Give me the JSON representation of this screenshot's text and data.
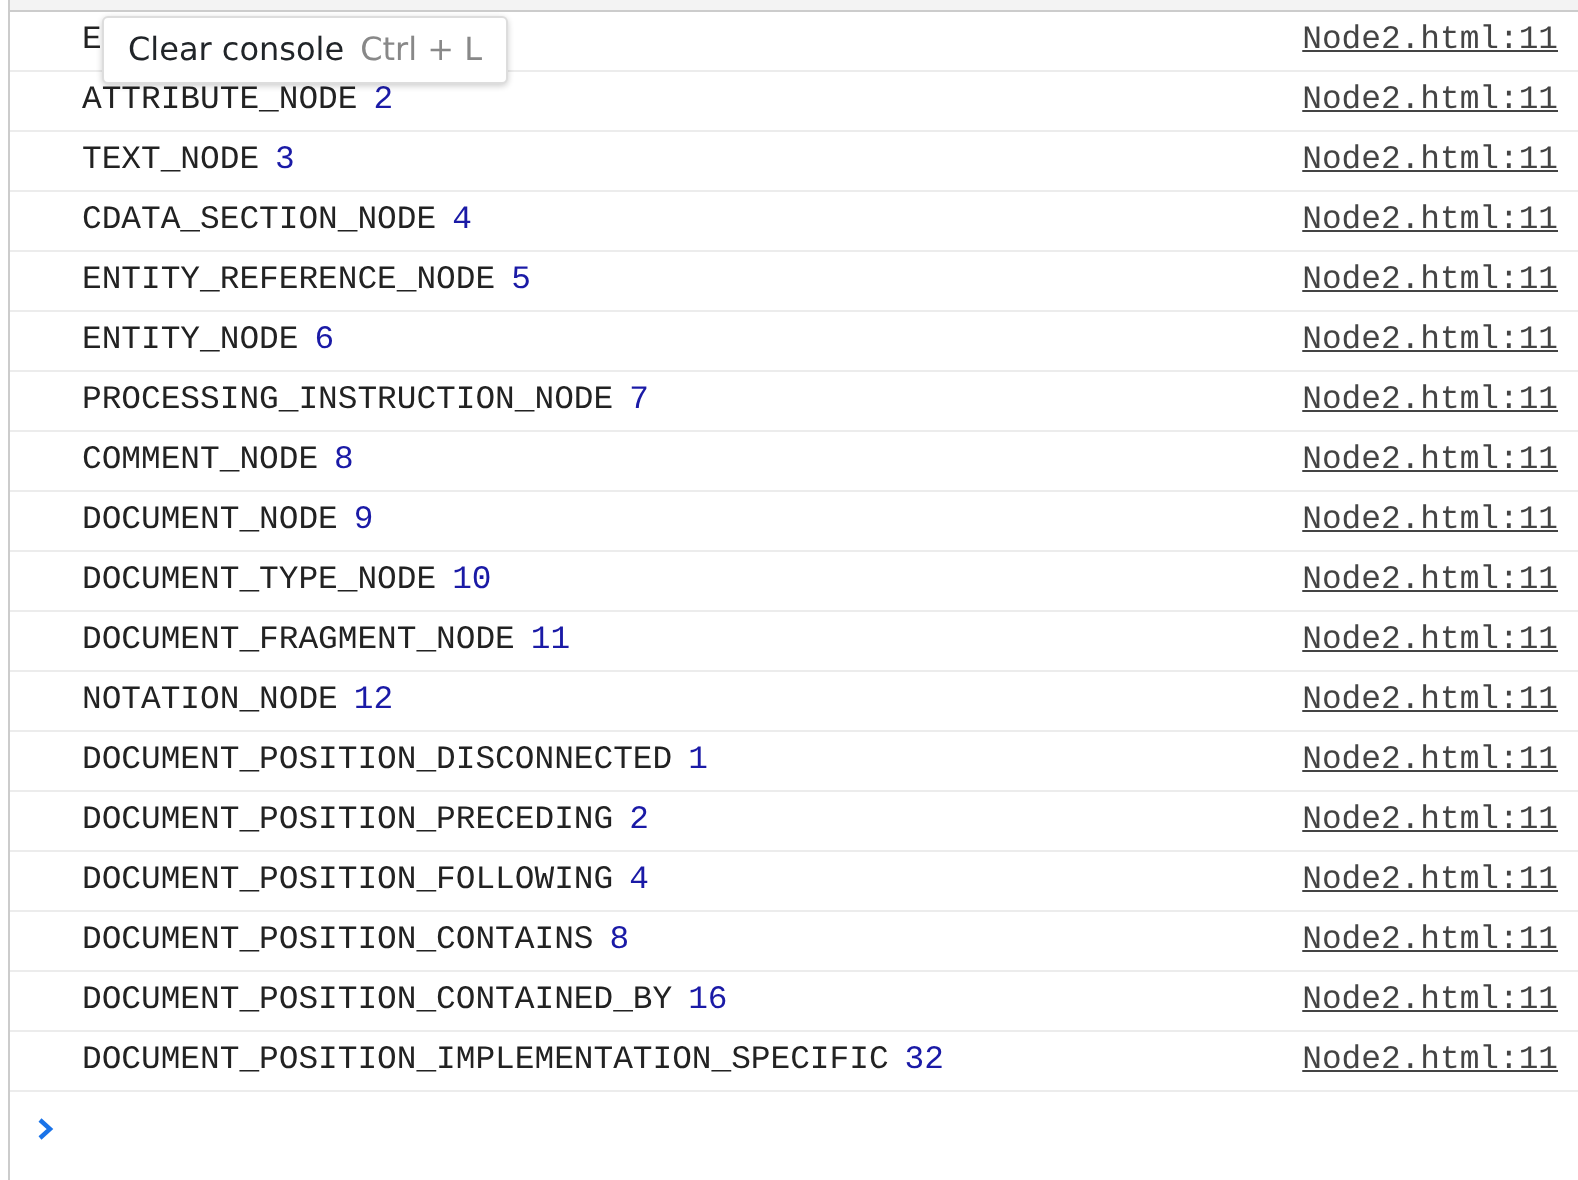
{
  "messages": [
    {
      "text": "E",
      "source": "Node2.html:11"
    },
    {
      "text": "ATTRIBUTE_NODE",
      "value": "2",
      "source": "Node2.html:11"
    },
    {
      "text": "TEXT_NODE",
      "value": "3",
      "source": "Node2.html:11"
    },
    {
      "text": "CDATA_SECTION_NODE",
      "value": "4",
      "source": "Node2.html:11"
    },
    {
      "text": "ENTITY_REFERENCE_NODE",
      "value": "5",
      "source": "Node2.html:11"
    },
    {
      "text": "ENTITY_NODE",
      "value": "6",
      "source": "Node2.html:11"
    },
    {
      "text": "PROCESSING_INSTRUCTION_NODE",
      "value": "7",
      "source": "Node2.html:11"
    },
    {
      "text": "COMMENT_NODE",
      "value": "8",
      "source": "Node2.html:11"
    },
    {
      "text": "DOCUMENT_NODE",
      "value": "9",
      "source": "Node2.html:11"
    },
    {
      "text": "DOCUMENT_TYPE_NODE",
      "value": "10",
      "source": "Node2.html:11"
    },
    {
      "text": "DOCUMENT_FRAGMENT_NODE",
      "value": "11",
      "source": "Node2.html:11"
    },
    {
      "text": "NOTATION_NODE",
      "value": "12",
      "source": "Node2.html:11"
    },
    {
      "text": "DOCUMENT_POSITION_DISCONNECTED",
      "value": "1",
      "source": "Node2.html:11"
    },
    {
      "text": "DOCUMENT_POSITION_PRECEDING",
      "value": "2",
      "source": "Node2.html:11"
    },
    {
      "text": "DOCUMENT_POSITION_FOLLOWING",
      "value": "4",
      "source": "Node2.html:11"
    },
    {
      "text": "DOCUMENT_POSITION_CONTAINS",
      "value": "8",
      "source": "Node2.html:11"
    },
    {
      "text": "DOCUMENT_POSITION_CONTAINED_BY",
      "value": "16",
      "source": "Node2.html:11"
    },
    {
      "text": "DOCUMENT_POSITION_IMPLEMENTATION_SPECIFIC",
      "value": "32",
      "source": "Node2.html:11"
    }
  ],
  "tooltip": {
    "label": "Clear console",
    "shortcut": "Ctrl + L"
  }
}
